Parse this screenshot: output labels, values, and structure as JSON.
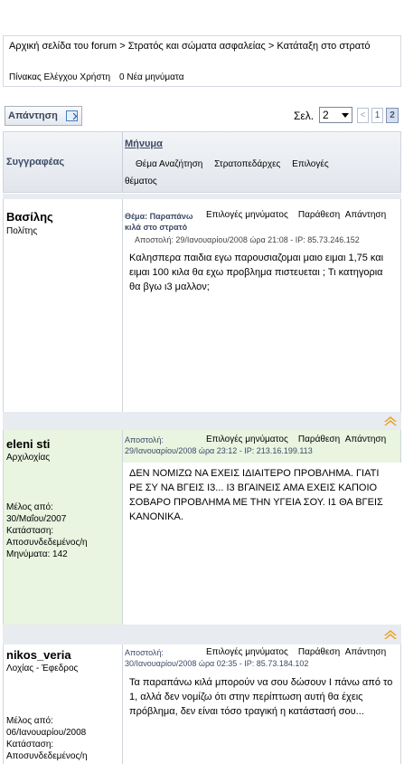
{
  "breadcrumb": {
    "items": [
      "Αρχική σελίδα του forum",
      "Στρατός και σώματα ασφαλείας",
      "Κατάταξη στο στρατό"
    ],
    "separator": ">"
  },
  "usercp": {
    "control_panel": "Πίνακας Ελέγχου Χρήστη",
    "new_messages": "0 Νέα μηνύματα"
  },
  "toolbar": {
    "reply_label": "Απάντηση",
    "page_label": "Σελ.",
    "page_selected": "2",
    "prev": "<",
    "pages": [
      "1",
      "2"
    ],
    "current_page": "2"
  },
  "header": {
    "author_col": "Συγγραφέας",
    "message_col": "Μήνυμα",
    "search_topic": "Θέμα Αναζήτηση",
    "forum_link": "Στρατοπεδάρχες",
    "options_word": "Επιλογές",
    "options_word2": "θέματος"
  },
  "posts": [
    {
      "author": "Βασίλης",
      "title": "Πολίτης",
      "info": [],
      "subject_line1": "Θέμα: Παραπάνω",
      "subject_line2": "κιλά στο στρατό",
      "msg_options": "Επιλογές μηνύματος",
      "quote": "Παράθεση",
      "reply": "Απάντηση",
      "posted": "Αποστολή: 29/Ιανουαρίου/2008 ώρα 21:08 - IP: 85.73.246.152",
      "text": "Καλησπερα παιδια εγω παρουσιαζομαι μαιο ειμαι 1,75 και ειμαι 100 κιλα θα εχω προβλημα πιστευεται ; Τι κατηγορια θα βγω ι3 μαλλον;"
    },
    {
      "author": "eleni sti",
      "title": "Αρχιλοχίας",
      "info": [
        "Μέλος από:",
        "30/Μαΐου/2007",
        "Κατάσταση:",
        "Αποσυνδεδεμένος/η",
        "Μηνύματα: 142"
      ],
      "posted_label": "Αποστολή:",
      "posted_date": "29/Ιανουαρίου/2008 ώρα 23:12",
      "ip_label": "IP: 213.16.199.113",
      "msg_options": "Επιλογές μηνύματος",
      "quote": "Παράθεση",
      "reply": "Απάντηση",
      "text": "ΔΕΝ ΝΟΜΙΖΩ ΝΑ ΕΧΕΙΣ ΙΔΙΑΙΤΕΡΟ ΠΡΟΒΛΗΜΑ. ΓΙΑΤΙ ΡΕ ΣΥ ΝΑ ΒΓΕΙΣ Ι3... Ι3 ΒΓΑΙΝΕΙΣ ΑΜΑ ΕΧΕΙΣ ΚΑΠΟΙΟ ΣΟΒΑΡΟ ΠΡΟΒΛΗΜΑ ΜΕ ΤΗΝ ΥΓΕΙΑ ΣΟΥ. Ι1 ΘΑ ΒΓΕΙΣ ΚΑΝΟΝΙΚΑ."
    },
    {
      "author": "nikos_veria",
      "title": "Λοχίας - Έφεδρος",
      "info": [
        "Μέλος από:",
        "06/Ιανουαρίου/2008",
        "Κατάσταση:",
        "Αποσυνδεδεμένος/η"
      ],
      "posted_label": "Αποστολή:",
      "posted_date": "30/Ιανουαρίου/2008 ώρα 02:35",
      "ip_label": "IP: 85.73.184.102",
      "msg_options": "Επιλογές μηνύματος",
      "quote": "Παράθεση",
      "reply": "Απάντηση",
      "text": "Τα παραπάνω κιλά μπορούν να σου δώσουν Ι πάνω από το 1, αλλά δεν νομίζω ότι στην περίπτωση αυτή θα έχεις πρόβλημα, δεν είναι τόσο τραγική η κατάστασή σου..."
    }
  ],
  "colors": {
    "accent": "#3b4b66",
    "post_green": "#e9f4e1",
    "up_icon": "#e8a020"
  },
  "icons": [
    "reply-icon",
    "dropdown-arrow-icon",
    "back-to-top-icon"
  ]
}
